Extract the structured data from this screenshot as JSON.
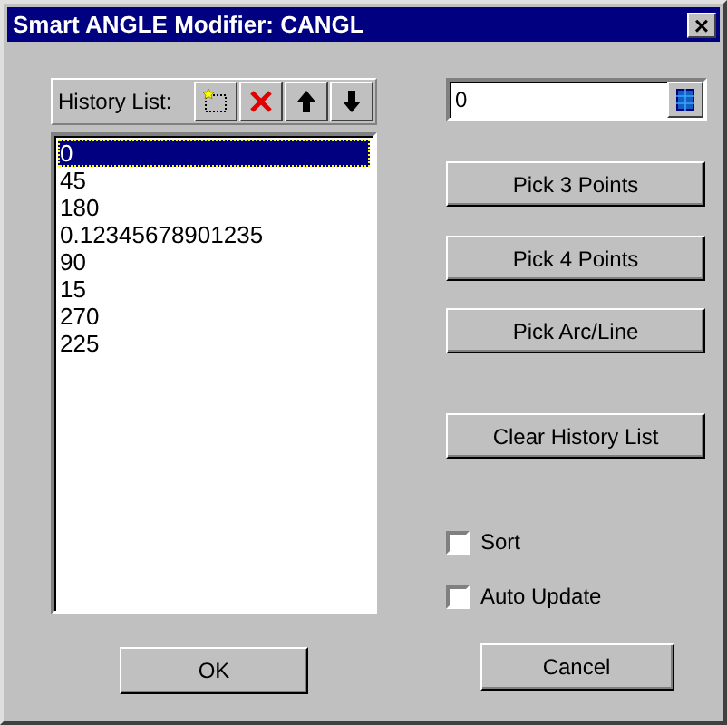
{
  "window": {
    "title": "Smart ANGLE Modifier: CANGL",
    "close": "×"
  },
  "history": {
    "label": "History List:",
    "items": [
      {
        "text": "0",
        "selected": true
      },
      {
        "text": "45",
        "selected": false
      },
      {
        "text": "180",
        "selected": false
      },
      {
        "text": "0.12345678901235",
        "selected": false
      },
      {
        "text": "90",
        "selected": false
      },
      {
        "text": "15",
        "selected": false
      },
      {
        "text": "270",
        "selected": false
      },
      {
        "text": "225",
        "selected": false
      }
    ]
  },
  "angle_field": {
    "value": "0"
  },
  "buttons": [
    {
      "label": "Pick 3 Points"
    },
    {
      "label": "Pick 4 Points"
    },
    {
      "label": "Pick Arc/Line"
    },
    {
      "label": "Clear History List"
    }
  ],
  "options": [
    {
      "label": "Sort",
      "checked": false
    },
    {
      "label": "Auto Update",
      "checked": false
    }
  ],
  "footer": [
    {
      "label": "OK"
    },
    {
      "label": "Cancel"
    }
  ]
}
